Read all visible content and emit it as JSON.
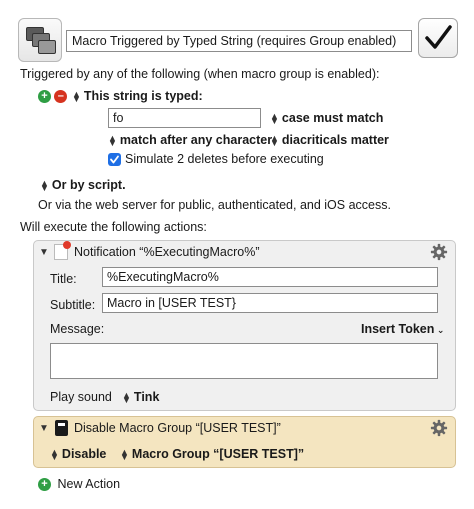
{
  "header": {
    "macro_name": "Macro Triggered by Typed String (requires Group enabled)",
    "icon": "macro-windows-icon",
    "enabled_icon": "checkmark-icon"
  },
  "triggers": {
    "heading": "Triggered by any of the following (when macro group is enabled):",
    "typed": {
      "label": "This string is typed:",
      "value": "fo",
      "case_option": "case must match",
      "match_option": "match after any character",
      "diacritics_option": "diacriticals matter",
      "simulate_label": "Simulate 2 deletes before executing",
      "simulate_checked": true
    },
    "or_by_script": "Or by script.",
    "web_server_note": "Or via the web server for public, authenticated, and iOS access."
  },
  "actions_heading": "Will execute the following actions:",
  "notification_action": {
    "title": "Notification “%ExecutingMacro%”",
    "title_label": "Title:",
    "title_value": "%ExecutingMacro%",
    "subtitle_label": "Subtitle:",
    "subtitle_value": "Macro in [USER TEST}",
    "message_label": "Message:",
    "message_value": "",
    "insert_token": "Insert Token",
    "play_sound_label": "Play sound",
    "sound_value": "Tink"
  },
  "disable_action": {
    "title": "Disable Macro Group “[USER TEST]”",
    "mode": "Disable",
    "group": "Macro Group “[USER TEST]”"
  },
  "new_action": "New Action",
  "colors": {
    "disable_panel_bg": "#f4e5c0",
    "notification_panel_bg": "#f0f0f0",
    "add_green": "#2f9e44",
    "remove_red": "#d6331f",
    "checkbox_blue": "#1f6fe5"
  }
}
